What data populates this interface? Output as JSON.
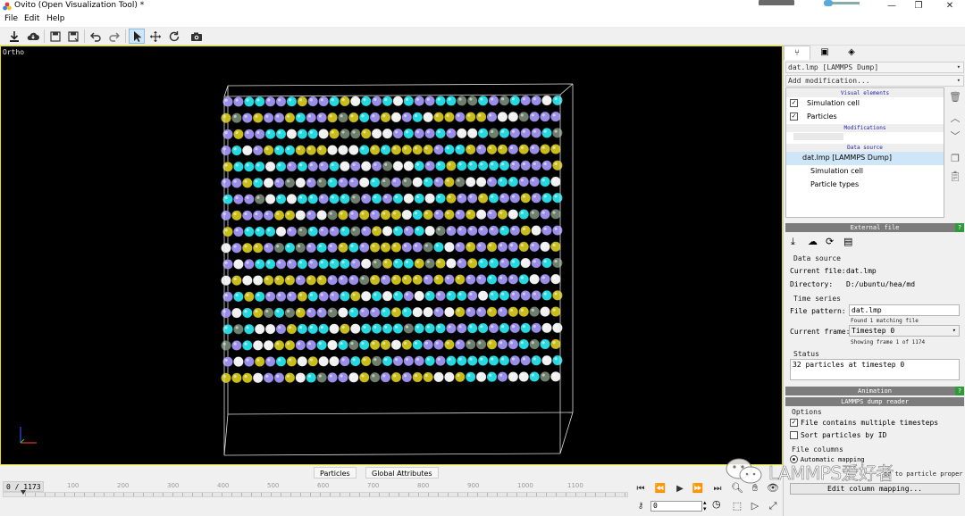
{
  "window": {
    "title": "Ovito (Open Visualization Tool) *",
    "controls": {
      "minimize": "—",
      "restore": "❐",
      "close": "✕"
    }
  },
  "menubar": {
    "items": [
      {
        "label": "File"
      },
      {
        "label": "Edit"
      },
      {
        "label": "Help"
      }
    ]
  },
  "toolbar": {
    "icons": [
      "load-file-icon",
      "load-remote-icon",
      "save-session-icon",
      "save-as-icon",
      "undo-icon",
      "redo-icon",
      "selection-mode-icon",
      "move-icon",
      "orbit-icon",
      "render-icon"
    ]
  },
  "viewport": {
    "caption": "Ortho",
    "background": "#000000",
    "particle_colors": {
      "type1": "#26d9e0",
      "type2": "#9a8ee8",
      "type3": "#c9bd1c",
      "type4": "#f1f1f1",
      "type5": "#6e7f6e"
    }
  },
  "bottom_tabs": {
    "tabs": [
      {
        "label": "Particles"
      },
      {
        "label": "Global Attributes"
      }
    ]
  },
  "timeline": {
    "frame_display": "0 / 1173",
    "tick_labels": [
      "100",
      "200",
      "300",
      "400",
      "500",
      "600",
      "700",
      "800",
      "900",
      "1000",
      "1100"
    ],
    "current_frame": 0,
    "spinner_value": "0"
  },
  "animation_controls": {
    "first_label": "⏮",
    "prev_label": "⏪",
    "play_label": "▶",
    "next_label": "⏩",
    "last_label": "⏭"
  },
  "right_panel": {
    "tabs": [
      "pipeline-icon",
      "render-icon",
      "overlay-icon"
    ],
    "pipeline_selector": "dat.lmp [LAMMPS Dump]",
    "add_modification": "Add modification...",
    "pipeline": {
      "visual_elements_header": "Visual elements",
      "visual_elements": [
        {
          "label": "Simulation cell",
          "checked": true
        },
        {
          "label": "Particles",
          "checked": true
        }
      ],
      "modifications_header": "Modifications",
      "data_source_header": "Data source",
      "data_source": "dat.lmp [LAMMPS Dump]",
      "data_source_children": [
        "Simulation cell",
        "Particle types"
      ]
    },
    "external_file": {
      "header": "External file",
      "data_source_label": "Data source",
      "current_file_label": "Current file:",
      "current_file": "dat.lmp",
      "directory_label": "Directory:",
      "directory": "D:/ubuntu/hea/md",
      "time_series_label": "Time series",
      "file_pattern_label": "File pattern:",
      "file_pattern": "dat.lmp",
      "found_note": "Found 1 matching file",
      "current_frame_label": "Current frame:",
      "current_frame": "Timestep 0",
      "showing_note": "Showing frame 1 of 1174",
      "status_label": "Status",
      "status_text": "32 particles at timestep 0"
    },
    "animation": {
      "header": "Animation"
    },
    "lammps_reader": {
      "header": "LAMMPS dump reader",
      "options_label": "Options",
      "multi_timestep_label": "File contains multiple timesteps",
      "multi_timestep_checked": true,
      "sort_label": "Sort particles by ID",
      "sort_checked": false,
      "file_columns_label": "File columns",
      "auto_mapping_label": "Automatic mapping",
      "mapping_note": "ed to particle proper",
      "edit_mapping_button": "Edit column mapping..."
    },
    "help_badge": "?"
  },
  "watermark": {
    "text": "LAMMPS爱好者"
  }
}
